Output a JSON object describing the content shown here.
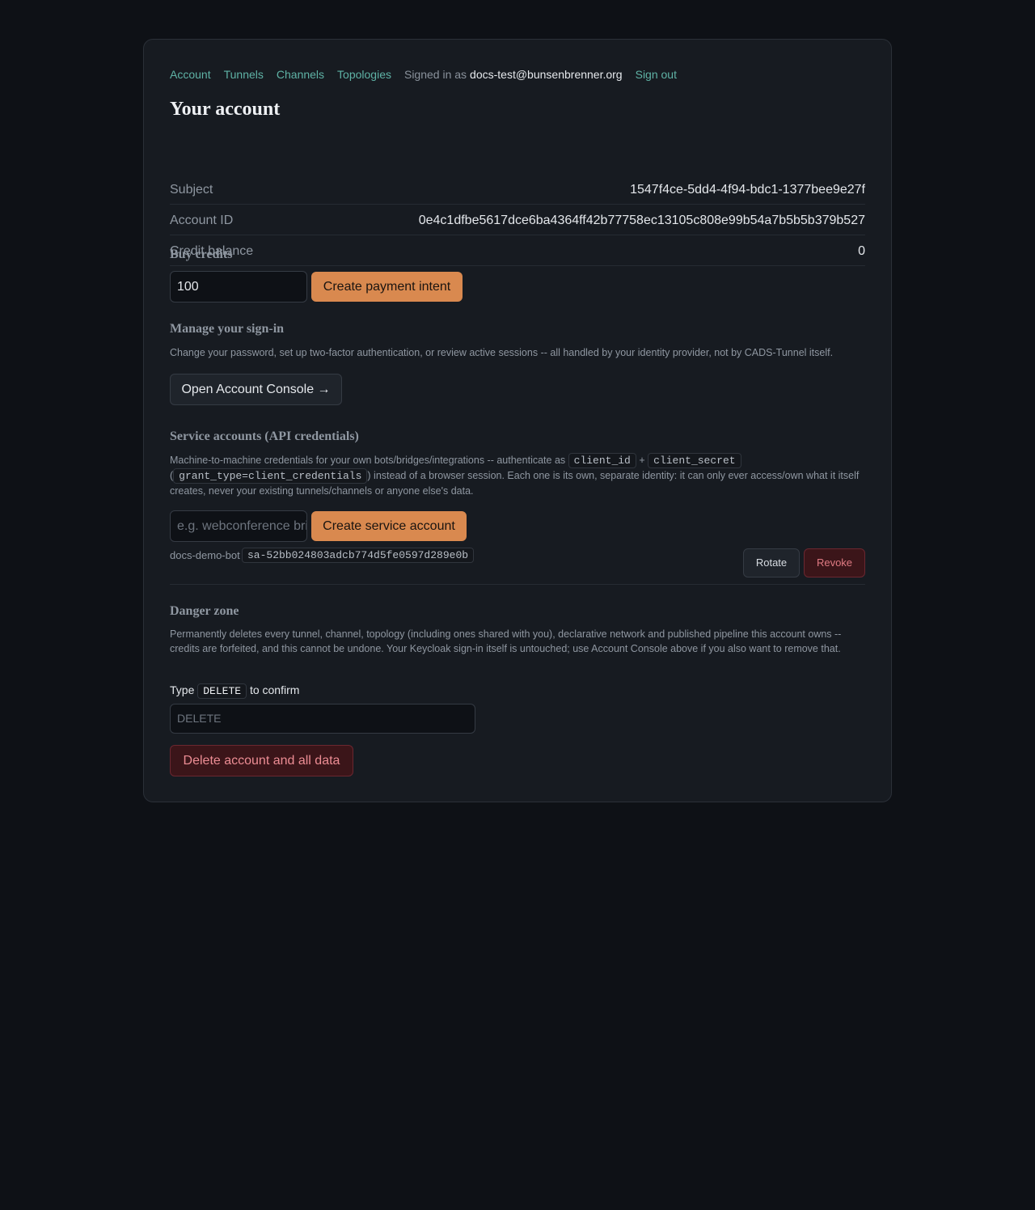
{
  "nav": {
    "links": [
      "Account",
      "Tunnels",
      "Channels",
      "Topologies"
    ],
    "signed_in_prefix": "Signed in as",
    "email": "docs-test@bunsenbrenner.org",
    "sign_out": "Sign out"
  },
  "page_title": "Your account",
  "account": [
    {
      "label": "Subject",
      "value": "1547f4ce-5dd4-4f94-bdc1-1377bee9e27f"
    },
    {
      "label": "Account ID",
      "value": "0e4c1dfbe5617dce6ba4364ff42b77758ec13105c808e99b54a7b5b5b379b527"
    },
    {
      "label": "Credit balance",
      "value": "0"
    }
  ],
  "buy_credits": {
    "heading": "Buy credits",
    "amount_value": "100",
    "button": "Create payment intent"
  },
  "signin": {
    "heading": "Manage your sign-in",
    "description": "Change your password, set up two-factor authentication, or review active sessions -- all handled by your identity provider, not by CADS-Tunnel itself.",
    "button": "Open Account Console →"
  },
  "service_accounts": {
    "heading": "Service accounts (API credentials)",
    "desc_part1": "Machine-to-machine credentials for your own bots/bridges/integrations -- authenticate as",
    "code_client_id": "client_id",
    "plus": "+",
    "code_client_secret": "client_secret",
    "paren_open": "(",
    "code_grant": "grant_type=client_credentials",
    "desc_part2": ") instead of a browser session. Each one is its own, separate identity: it can only ever access/own what it itself creates, never your existing tunnels/channels or anyone else's data.",
    "name_placeholder": "e.g. webconference bridge",
    "create_button": "Create service account",
    "items": [
      {
        "name": "docs-demo-bot",
        "client_id": "sa-52bb024803adcb774d5fe0597d289e0b",
        "rotate": "Rotate",
        "revoke": "Revoke"
      }
    ]
  },
  "danger": {
    "heading": "Danger zone",
    "description": "Permanently deletes every tunnel, channel, topology (including ones shared with you), declarative network and published pipeline this account owns -- credits are forfeited, and this cannot be undone. Your Keycloak sign-in itself is untouched; use Account Console above if you also want to remove that.",
    "confirm_prefix": "Type",
    "confirm_word": "DELETE",
    "confirm_suffix": "to confirm",
    "confirm_placeholder": "DELETE",
    "delete_button": "Delete account and all data"
  },
  "colors": {
    "accent": "#d9894f",
    "link": "#5fb3a6",
    "danger": "#3b1519",
    "background": "#0e1116",
    "card": "#171b21"
  }
}
